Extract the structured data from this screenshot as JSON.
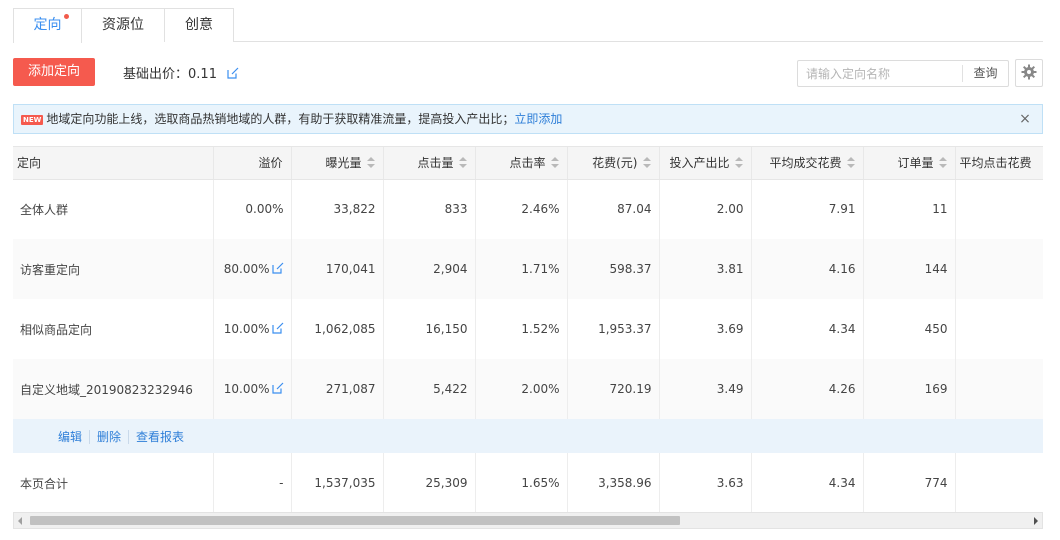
{
  "tabs": [
    {
      "label": "定向",
      "active": true,
      "has_dot": true
    },
    {
      "label": "资源位",
      "active": false
    },
    {
      "label": "创意",
      "active": false
    }
  ],
  "toolbar": {
    "add_label": "添加定向",
    "base_bid_label": "基础出价：",
    "base_bid_value": "0.11",
    "search_placeholder": "请输入定向名称",
    "search_button": "查询",
    "settings_icon": "gear-icon"
  },
  "notice": {
    "badge": "NEW",
    "text": "地域定向功能上线，选取商品热销地域的人群，有助于获取精准流量，提高投入产出比；",
    "link": "立即添加",
    "close": "×"
  },
  "table": {
    "columns": [
      "定向",
      "溢价",
      "曝光量",
      "点击量",
      "点击率",
      "花费(元)",
      "投入产出比",
      "平均成交花费",
      "订单量",
      "平均点击花费"
    ],
    "rows": [
      {
        "name": "全体人群",
        "premium": "0.00%",
        "editable": false,
        "impressions": "33,822",
        "clicks": "833",
        "ctr": "2.46%",
        "cost": "87.04",
        "roi": "2.00",
        "avg_deal_cost": "7.91",
        "orders": "11",
        "avg_click_cost": ""
      },
      {
        "name": "访客重定向",
        "premium": "80.00%",
        "editable": true,
        "impressions": "170,041",
        "clicks": "2,904",
        "ctr": "1.71%",
        "cost": "598.37",
        "roi": "3.81",
        "avg_deal_cost": "4.16",
        "orders": "144",
        "avg_click_cost": ""
      },
      {
        "name": "相似商品定向",
        "premium": "10.00%",
        "editable": true,
        "impressions": "1,062,085",
        "clicks": "16,150",
        "ctr": "1.52%",
        "cost": "1,953.37",
        "roi": "3.69",
        "avg_deal_cost": "4.34",
        "orders": "450",
        "avg_click_cost": ""
      },
      {
        "name": "自定义地域_20190823232946",
        "premium": "10.00%",
        "editable": true,
        "impressions": "271,087",
        "clicks": "5,422",
        "ctr": "2.00%",
        "cost": "720.19",
        "roi": "3.49",
        "avg_deal_cost": "4.26",
        "orders": "169",
        "avg_click_cost": ""
      }
    ],
    "row_actions": [
      "编辑",
      "删除",
      "查看报表"
    ],
    "total": {
      "name": "本页合计",
      "premium": "-",
      "impressions": "1,537,035",
      "clicks": "25,309",
      "ctr": "1.65%",
      "cost": "3,358.96",
      "roi": "3.63",
      "avg_deal_cost": "4.34",
      "orders": "774",
      "avg_click_cost": ""
    }
  },
  "colors": {
    "accent": "#3b8ff0",
    "primary_button": "#f55a4e",
    "notice_bg": "#e9f4fc",
    "link": "#2f7fd8"
  }
}
